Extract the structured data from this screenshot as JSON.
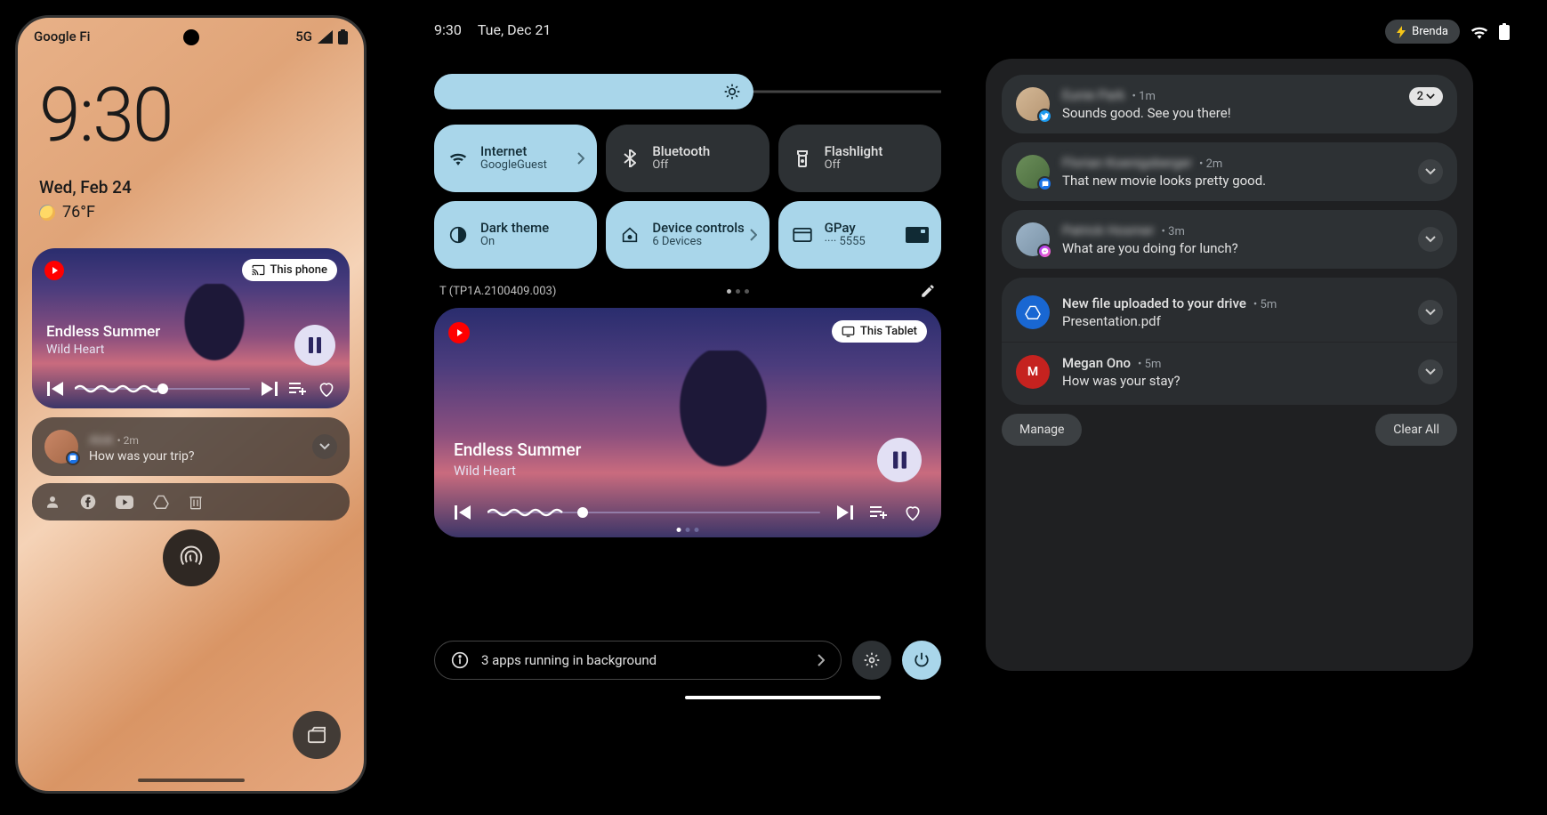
{
  "phone": {
    "carrier": "Google Fi",
    "network": "5G",
    "clock": "9:30",
    "date": "Wed, Feb 24",
    "temperature": "76°F",
    "media": {
      "cast_target": "This phone",
      "title": "Endless Summer",
      "artist": "Wild Heart"
    },
    "notification": {
      "sender": "Alok",
      "time": "2m",
      "message": "How was your trip?"
    }
  },
  "tablet": {
    "status_time": "9:30",
    "status_date": "Tue, Dec 21",
    "user": "Brenda",
    "tiles": {
      "internet": {
        "label": "Internet",
        "sub": "GoogleGuest"
      },
      "bluetooth": {
        "label": "Bluetooth",
        "sub": "Off"
      },
      "flashlight": {
        "label": "Flashlight",
        "sub": "Off"
      },
      "darktheme": {
        "label": "Dark theme",
        "sub": "On"
      },
      "devicecontrols": {
        "label": "Device controls",
        "sub": "6 Devices"
      },
      "gpay": {
        "label": "GPay",
        "sub": "···· 5555"
      }
    },
    "build": "T (TP1A.2100409.003)",
    "media": {
      "cast_target": "This Tablet",
      "title": "Endless Summer",
      "artist": "Wild Heart"
    },
    "bg_apps": "3 apps running in background"
  },
  "notifications": {
    "items": [
      {
        "sender": "Eunie Park",
        "time": "1m",
        "message": "Sounds good. See you there!",
        "count": "2"
      },
      {
        "sender": "Florian Koenigsberger",
        "time": "2m",
        "message": "That new movie looks pretty good."
      },
      {
        "sender": "Patrick Hosmer",
        "time": "3m",
        "message": "What are you doing for lunch?"
      },
      {
        "sender": "New file uploaded to your drive",
        "time": "5m",
        "message": "Presentation.pdf"
      },
      {
        "sender": "Megan Ono",
        "time": "5m",
        "message": "How was your stay?"
      }
    ],
    "manage": "Manage",
    "clear_all": "Clear All"
  }
}
